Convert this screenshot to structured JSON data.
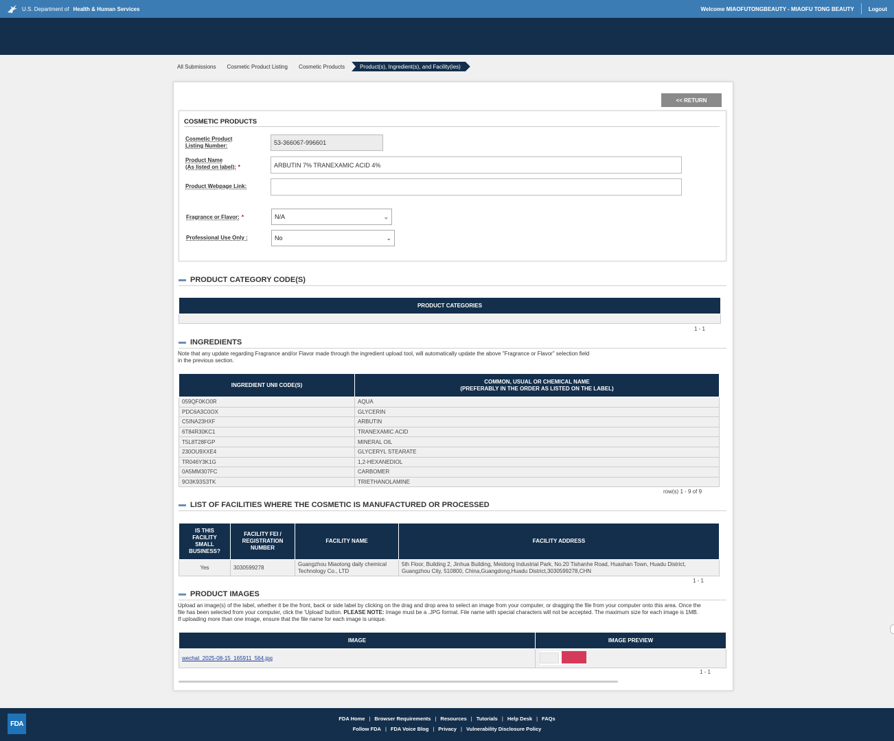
{
  "topbar": {
    "agency_prefix": "U.S. Department of",
    "agency_name": "Health & Human Services",
    "welcome": "Welcome MIAOFUTONGBEAUTY - MIAOFU TONG BEAUTY",
    "logout": "Logout"
  },
  "breadcrumbs": [
    "All Submissions",
    "Cosmetic Product Listing",
    "Cosmetic Products",
    "Product(s), Ingredient(s), and Facility(ies)"
  ],
  "return_label": "<< RETURN",
  "cosmetic_products": {
    "title": "COSMETIC PRODUCTS",
    "listing_label_1": "Cosmetic Product",
    "listing_label_2": "Listing Number:",
    "listing_value": "53-366067-996601",
    "name_label_1": "Product Name",
    "name_label_2": "(As listed on label):",
    "name_value": "ARBUTIN 7% TRANEXAMIC ACID 4%",
    "webpage_label": "Product Webpage Link:",
    "webpage_value": "",
    "fragrance_label": "Fragrance or Flavor:",
    "fragrance_value": "N/A",
    "professional_label": "Professional Use Only :",
    "professional_value": "No",
    "required_mark": "*"
  },
  "category": {
    "title": "PRODUCT CATEGORY CODE(S)",
    "header": "PRODUCT CATEGORIES",
    "pager": "1 - 1"
  },
  "ingredients": {
    "title": "INGREDIENTS",
    "note_1": "Note that any update regarding Fragrance and/or Flavor made through the ingredient upload tool, will automatically update the above \"Fragrance or Flavor\" selection field",
    "note_2": "in the previous section.",
    "col_1": "INGREDIENT UNII CODE(S)",
    "col_2a": "COMMON, USUAL OR CHEMICAL NAME",
    "col_2b": "(PREFERABLY IN THE ORDER AS LISTED ON THE LABEL)",
    "rows": [
      {
        "code": "059QF0KO0R",
        "name": "AQUA"
      },
      {
        "code": "PDC6A3C0OX",
        "name": "GLYCERIN"
      },
      {
        "code": "C5INA23HXF",
        "name": "ARBUTIN"
      },
      {
        "code": "6T84R30KC1",
        "name": "TRANEXAMIC ACID"
      },
      {
        "code": "T5L8T28FGP",
        "name": "MINERAL OIL"
      },
      {
        "code": "230OU9XXE4",
        "name": "GLYCERYL STEARATE"
      },
      {
        "code": "TR046Y3K1G",
        "name": "1,2-HEXANEDIOL"
      },
      {
        "code": "0A5MM307FC",
        "name": "CARBOMER"
      },
      {
        "code": "9O3K93S3TK",
        "name": "TRIETHANOLAMINE"
      }
    ],
    "pager": "row(s) 1 - 9 of 9"
  },
  "facilities": {
    "title": "LIST OF FACILITIES WHERE THE COSMETIC IS MANUFACTURED OR PROCESSED",
    "col_small_1": "IS THIS",
    "col_small_2": "FACILITY",
    "col_small_3": "SMALL",
    "col_small_4": "BUSINESS?",
    "col_fei_1": "FACILITY FEI /",
    "col_fei_2": "REGISTRATION",
    "col_fei_3": "NUMBER",
    "col_name": "FACILITY NAME",
    "col_address": "FACILITY ADDRESS",
    "row": {
      "small": "Yes",
      "fei": "3030599278",
      "name_1": "Guangzhou Miaotong daily chemical",
      "name_2": "Technology Co., LTD",
      "address_1": "5th Floor, Building 2, Jinhua Building, Meidong Industrial Park, No.20 Tishanhe Road, Huashan Town, Huadu District,",
      "address_2": "Guangzhou City, 510800, China,Guangdong,Huadu District,3030599278,CHN"
    },
    "pager": "1 - 1"
  },
  "images": {
    "title": "PRODUCT IMAGES",
    "note_1": "Upload an image(s) of the label, whether it be the front, back or side label by clicking on the drag and drop area to select an image from your computer, or dragging the file from your computer onto this area. Once the",
    "note_2a": "file has been selected from your computer, click the 'Upload' button.",
    "note_2b": "PLEASE NOTE:",
    "note_2c": "Image must be a .JPG format. File name with special characters will not be accepted. The maximum size for each image is 1MB.",
    "note_3": "If uploading more than one image, ensure that the file name for each image is unique.",
    "col_image": "IMAGE",
    "col_preview": "IMAGE PREVIEW",
    "file": "wechat_2025-08-15_165911_564.jpg",
    "pager": "1 - 1"
  },
  "footer": {
    "logo": "FDA",
    "links_1": [
      "FDA Home",
      "Browser Requirements",
      "Resources",
      "Tutorials",
      "Help Desk",
      "FAQs"
    ],
    "links_2": [
      "Follow FDA",
      "FDA Voice Blog",
      "Privacy",
      "Vulnerability Disclosure Policy"
    ],
    "separator": "|"
  },
  "colors": {
    "topbar": "#3c7cb4",
    "navy": "#132f4c",
    "required": "#cc0000"
  }
}
